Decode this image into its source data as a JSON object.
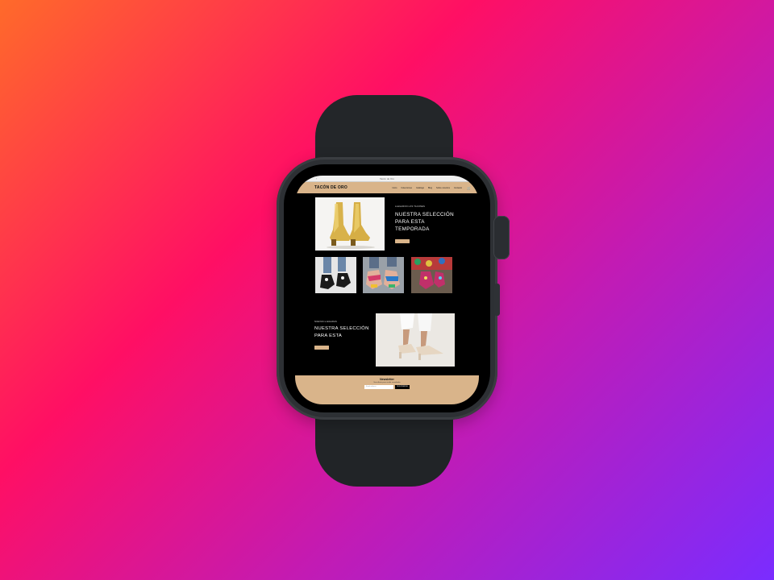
{
  "browser": {
    "url": "Tacón de Oro",
    "back": "‹"
  },
  "site": {
    "logo": "TACÓN DE ORO",
    "nav": [
      "Inicio",
      "Colecciones",
      "Catálogo",
      "Blog",
      "Sobre nosotros",
      "Contacto"
    ],
    "cart_icon": "cart-icon"
  },
  "hero": {
    "eyebrow": "LLEGARON LOS TACONES",
    "title_lines": [
      "NUESTRA SELECCIÓN",
      "PARA ESTA",
      "TEMPORADA"
    ]
  },
  "feature": {
    "eyebrow": "NUEVAS LLEGADAS",
    "title_lines": [
      "NUESTRA SELECCIÓN",
      "PARA ESTA"
    ]
  },
  "newsletter": {
    "title": "Newsletter",
    "subtitle": "Suscríbete para recibir novedades",
    "placeholder": "Email address",
    "button": "SUSCRIBIRSE"
  },
  "colors": {
    "accent": "#d9b48a",
    "background": "#000000"
  }
}
